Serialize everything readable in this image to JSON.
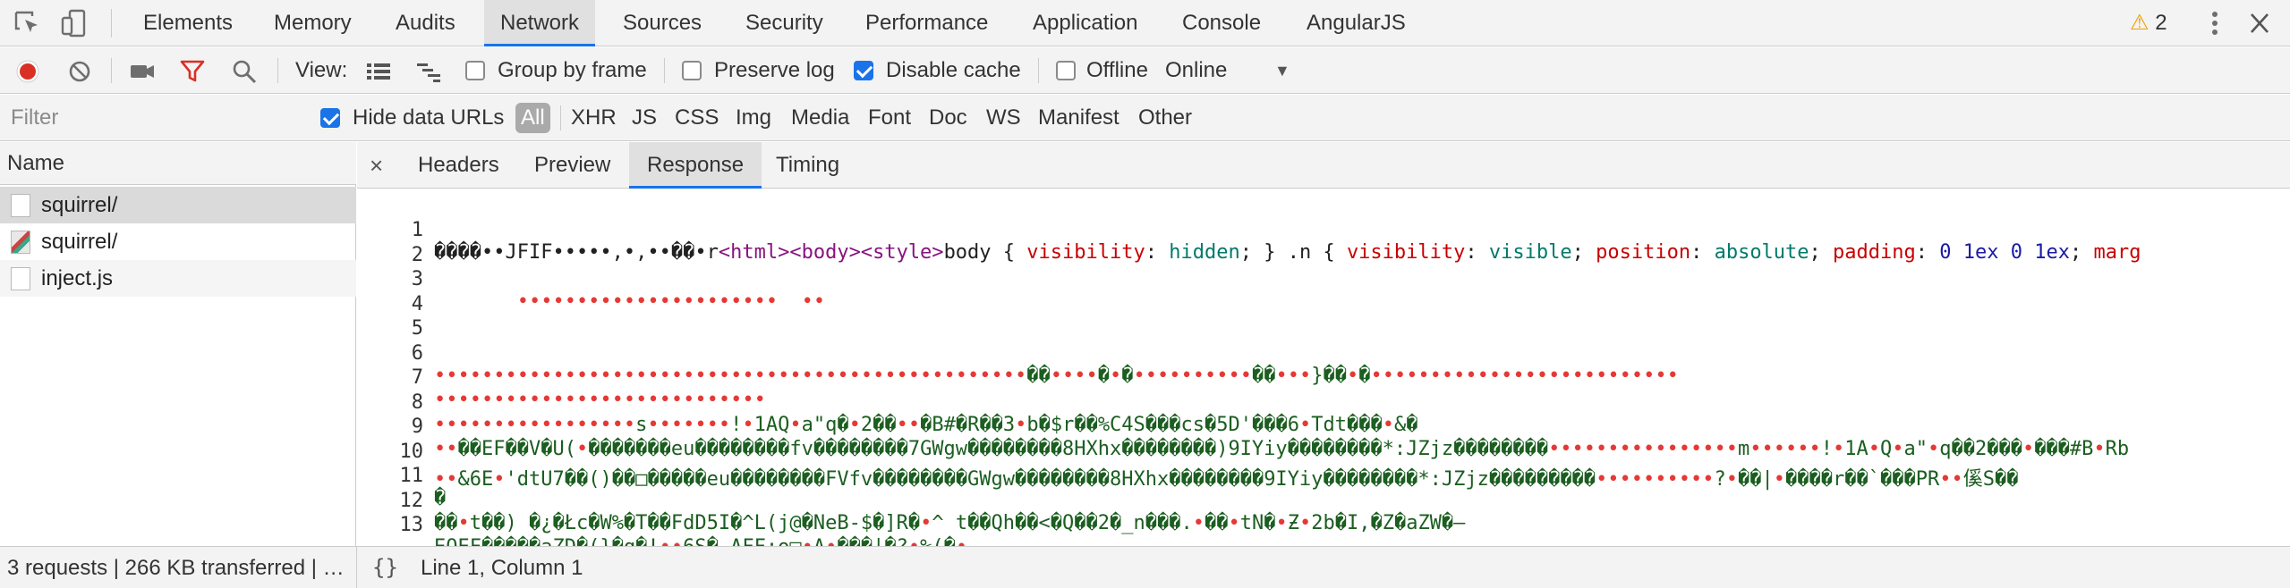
{
  "panel_tabs": [
    "Elements",
    "Memory",
    "Audits",
    "Network",
    "Sources",
    "Security",
    "Performance",
    "Application",
    "Console",
    "AngularJS"
  ],
  "active_panel": "Network",
  "warning_count": "2",
  "toolbar": {
    "view_label": "View:",
    "group_by_frame": "Group by frame",
    "preserve_log": "Preserve log",
    "disable_cache": "Disable cache",
    "offline": "Offline",
    "throttle": "Online"
  },
  "filter": {
    "placeholder": "Filter",
    "hide_data_urls": "Hide data URLs",
    "types": [
      "All",
      "XHR",
      "JS",
      "CSS",
      "Img",
      "Media",
      "Font",
      "Doc",
      "WS",
      "Manifest",
      "Other"
    ]
  },
  "request_list": {
    "header": "Name",
    "items": [
      {
        "name": "squirrel/",
        "icon": "document-icon"
      },
      {
        "name": "squirrel/",
        "icon": "image-icon"
      },
      {
        "name": "inject.js",
        "icon": "document-icon"
      }
    ]
  },
  "detail_tabs": [
    "Headers",
    "Preview",
    "Response",
    "Timing"
  ],
  "active_detail_tab": "Response",
  "response_lines": [
    "1",
    "2",
    "3",
    "4",
    "5",
    "6",
    "7",
    "8",
    "9",
    "10",
    "11",
    "12",
    "13",
    ""
  ],
  "status": {
    "summary": "3 requests | 266 KB transferred | …",
    "braces": "{}",
    "cursor": "Line 1, Column 1"
  },
  "colors": {
    "accent": "#1a73e8",
    "record_red": "#d93025",
    "warning": "#f2a000",
    "code_green": "#1b5e20",
    "tag_purple": "#881280",
    "css_prop_red": "#c80000",
    "css_value_blue": "#1a1aa6"
  }
}
